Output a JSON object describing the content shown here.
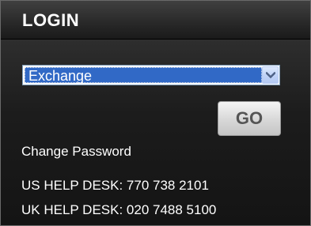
{
  "header": {
    "title": "LOGIN"
  },
  "login_form": {
    "server_select": {
      "selected_value": "Exchange",
      "arrow_icon": "chevron-down-icon"
    },
    "go_label": "GO",
    "change_password_label": "Change Password"
  },
  "help_desk": {
    "us_line": "US HELP DESK: 770 738 2101",
    "uk_line": "UK HELP DESK: 020 7488 5100"
  },
  "colors": {
    "panel_bg": "#141414",
    "header_bg": "#2a2a2a",
    "select_highlight": "#3169c6",
    "text": "#ffffff",
    "button_text": "#555555"
  }
}
